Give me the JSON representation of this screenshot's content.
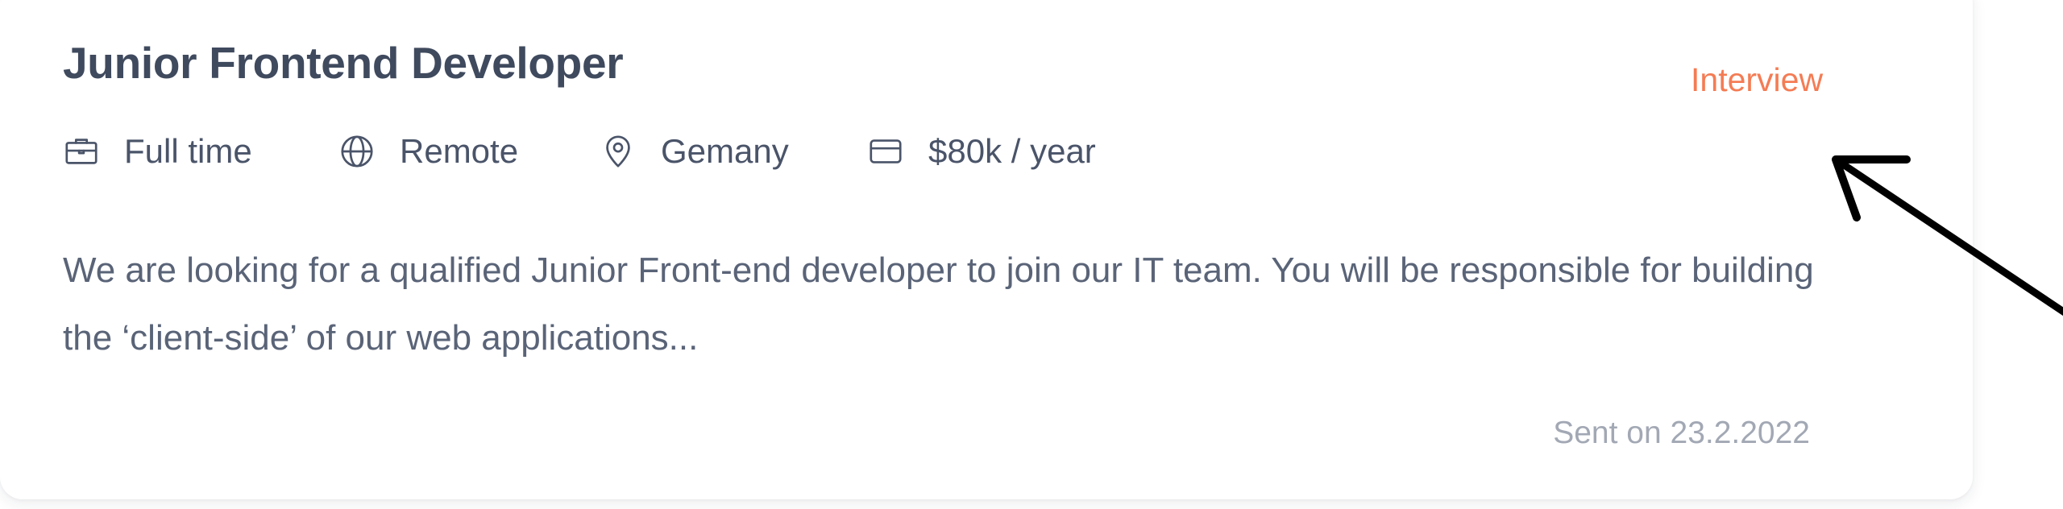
{
  "job": {
    "title": "Junior Frontend Developer",
    "status": "Interview",
    "status_color": "#f47c54",
    "meta": [
      {
        "icon": "briefcase-icon",
        "label": "Full time"
      },
      {
        "icon": "globe-icon",
        "label": "Remote"
      },
      {
        "icon": "location-pin-icon",
        "label": "Gemany"
      },
      {
        "icon": "wallet-icon",
        "label": "$80k / year"
      }
    ],
    "description": "We are looking for a qualified Junior Front-end developer to join our IT team. You will be responsible for building the ‘client-side’ of our web applications...",
    "sent": "Sent on 23.2.2022"
  },
  "annotation": {
    "icon": "arrow-icon",
    "target": "Interview"
  }
}
